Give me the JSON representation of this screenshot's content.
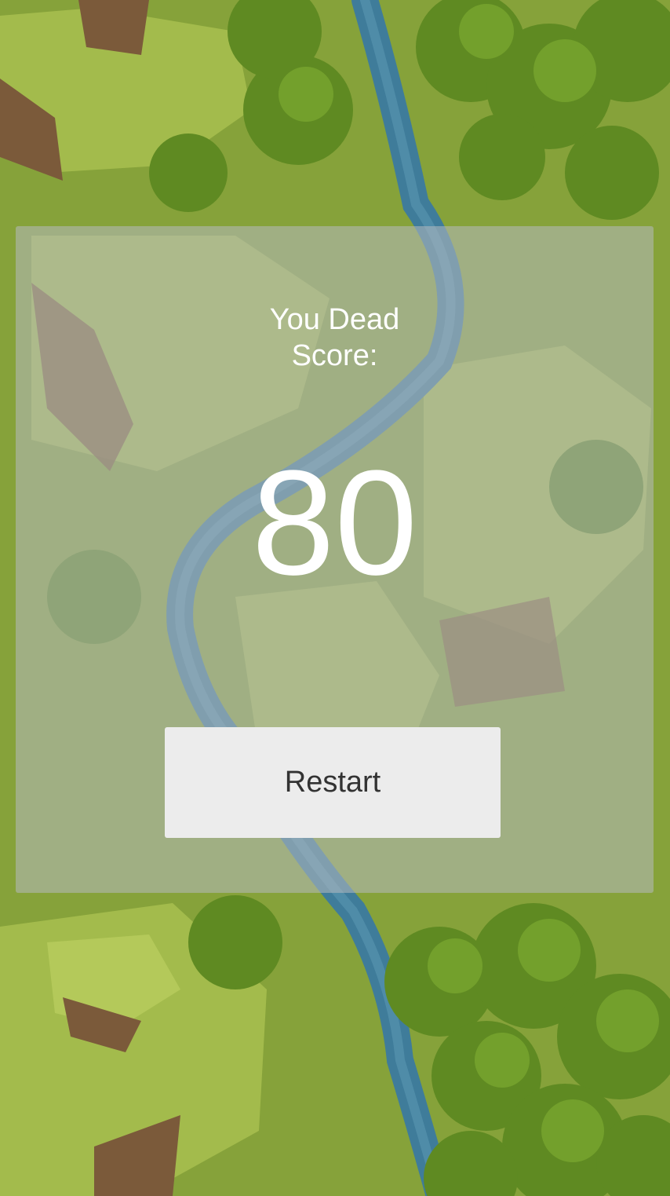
{
  "background": {
    "icon": "forest-river-map-icon",
    "colors": {
      "grass": "#8aa53a",
      "grass_light": "#a8bf4f",
      "trees": "#5f8a22",
      "trees_dark": "#3f6617",
      "cliff": "#7b5a3a",
      "river": "#3f7c9a"
    }
  },
  "dialog": {
    "title_line1": "You Dead",
    "title_line2": "Score:",
    "score": "80",
    "restart_label": "Restart",
    "overlay_color": "#b6b9c0",
    "button_color": "#ececec"
  }
}
